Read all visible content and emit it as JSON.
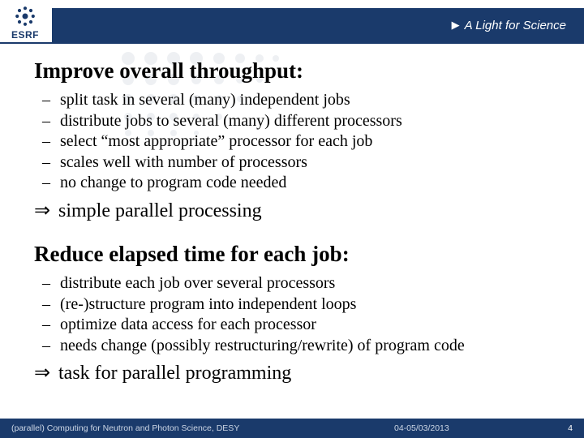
{
  "header": {
    "logo_text": "ESRF",
    "tagline": "A Light for Science"
  },
  "section1": {
    "heading": "Improve overall throughput:",
    "bullets": [
      "split task in several (many) independent jobs",
      "distribute jobs to several (many) different processors",
      "select “most appropriate” processor for each job",
      "scales well with number of processors",
      "no change to program code needed"
    ],
    "conclusion": "simple parallel processing"
  },
  "section2": {
    "heading": "Reduce elapsed time for each job:",
    "bullets": [
      "distribute each job over several processors",
      "(re-)structure program into independent loops",
      "optimize data access for each processor",
      "needs change (possibly restructuring/rewrite) of program code"
    ],
    "conclusion": "task for parallel programming"
  },
  "footer": {
    "left": "(parallel) Computing for Neutron and Photon Science, DESY",
    "date": "04-05/03/2013",
    "page": "4"
  },
  "glyphs": {
    "dash": "–",
    "implies": "⇒",
    "tri": "▶"
  }
}
